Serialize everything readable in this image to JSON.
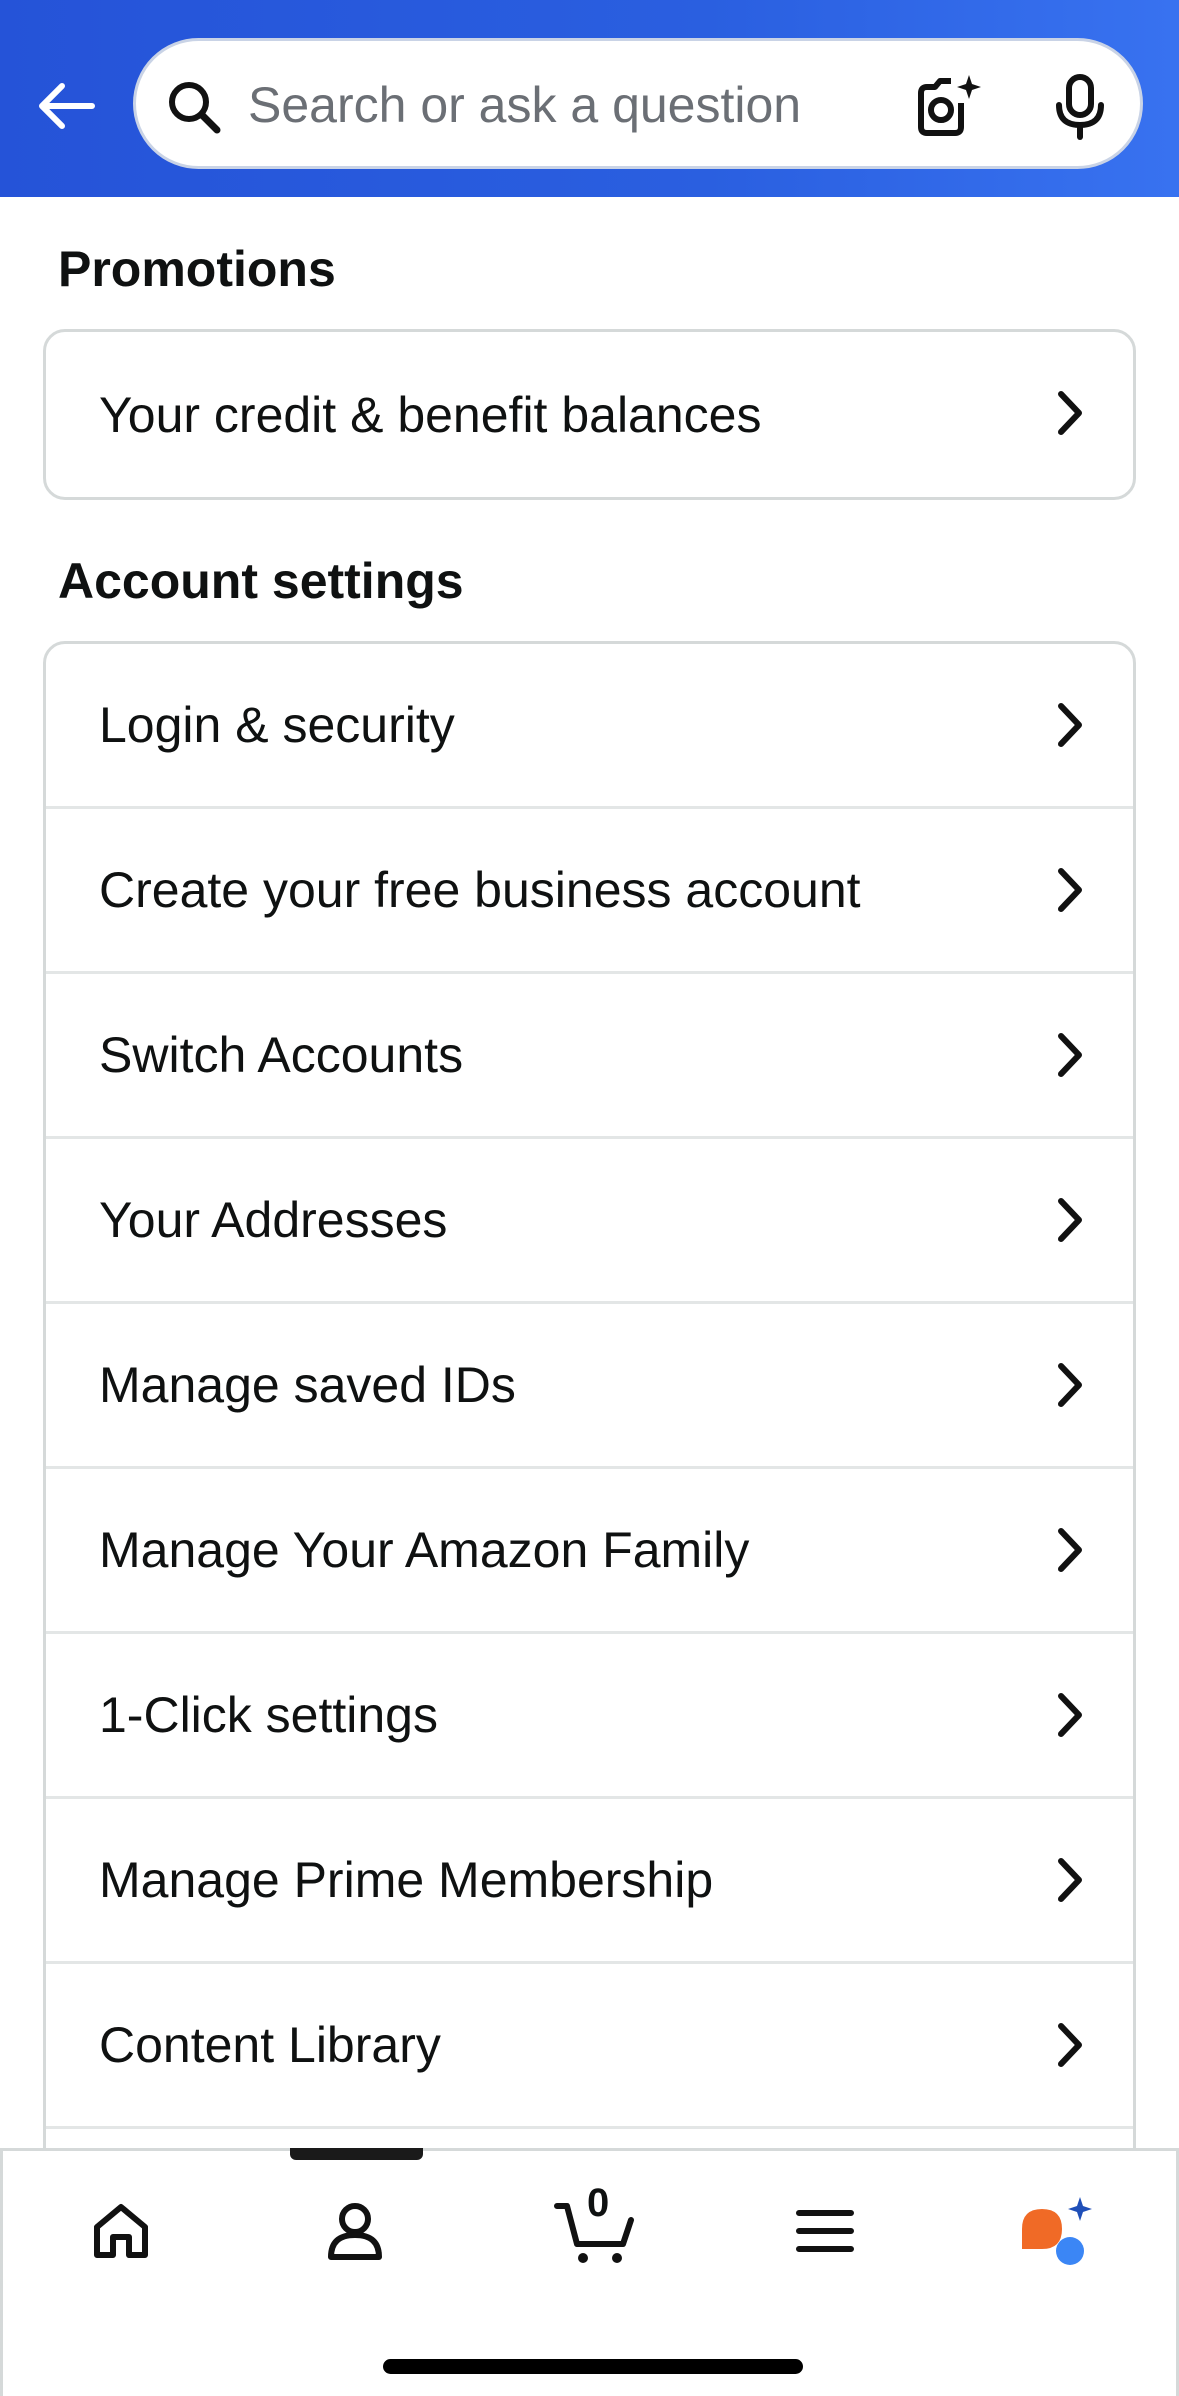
{
  "header": {
    "back_icon": "arrow-left-icon",
    "search": {
      "placeholder": "Search or ask a question",
      "value": ""
    },
    "camera_icon": "camera-sparkle-icon",
    "mic_icon": "microphone-icon",
    "colors": {
      "start": "#2553d8",
      "end": "#3872f0"
    }
  },
  "promotions": {
    "title": "Promotions",
    "items": [
      {
        "label": "Your credit & benefit balances"
      }
    ]
  },
  "account_settings": {
    "title": "Account settings",
    "items": [
      {
        "label": "Login & security"
      },
      {
        "label": "Create your free business account"
      },
      {
        "label": "Switch Accounts"
      },
      {
        "label": "Your Addresses"
      },
      {
        "label": "Manage saved IDs"
      },
      {
        "label": "Manage Your Amazon Family"
      },
      {
        "label": "1-Click settings"
      },
      {
        "label": "Manage Prime Membership"
      },
      {
        "label": "Content Library"
      }
    ]
  },
  "tabbar": {
    "tabs": [
      {
        "icon": "home-icon"
      },
      {
        "icon": "account-icon"
      },
      {
        "icon": "cart-icon",
        "count": "0"
      },
      {
        "icon": "menu-icon"
      },
      {
        "icon": "rufus-ai-icon"
      }
    ],
    "active_tab": "account"
  }
}
